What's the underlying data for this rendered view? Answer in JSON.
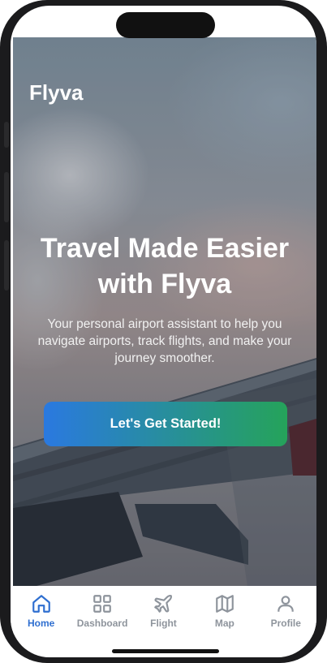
{
  "app": {
    "brand": "Flyva"
  },
  "hero": {
    "headline": "Travel Made Easier with Flyva",
    "subtitle": "Your personal airport assistant to help you navigate airports, track flights, and make your journey smoother.",
    "cta_label": "Let's Get Started!"
  },
  "nav": {
    "items": [
      {
        "label": "Home",
        "icon": "home-icon",
        "active": true
      },
      {
        "label": "Dashboard",
        "icon": "dashboard-icon",
        "active": false
      },
      {
        "label": "Flight",
        "icon": "plane-icon",
        "active": false
      },
      {
        "label": "Map",
        "icon": "map-icon",
        "active": false
      },
      {
        "label": "Profile",
        "icon": "user-icon",
        "active": false
      }
    ]
  },
  "colors": {
    "active": "#2f6fd0",
    "inactive": "#8e949c",
    "cta_start": "#2a79e0",
    "cta_end": "#25a35a"
  }
}
